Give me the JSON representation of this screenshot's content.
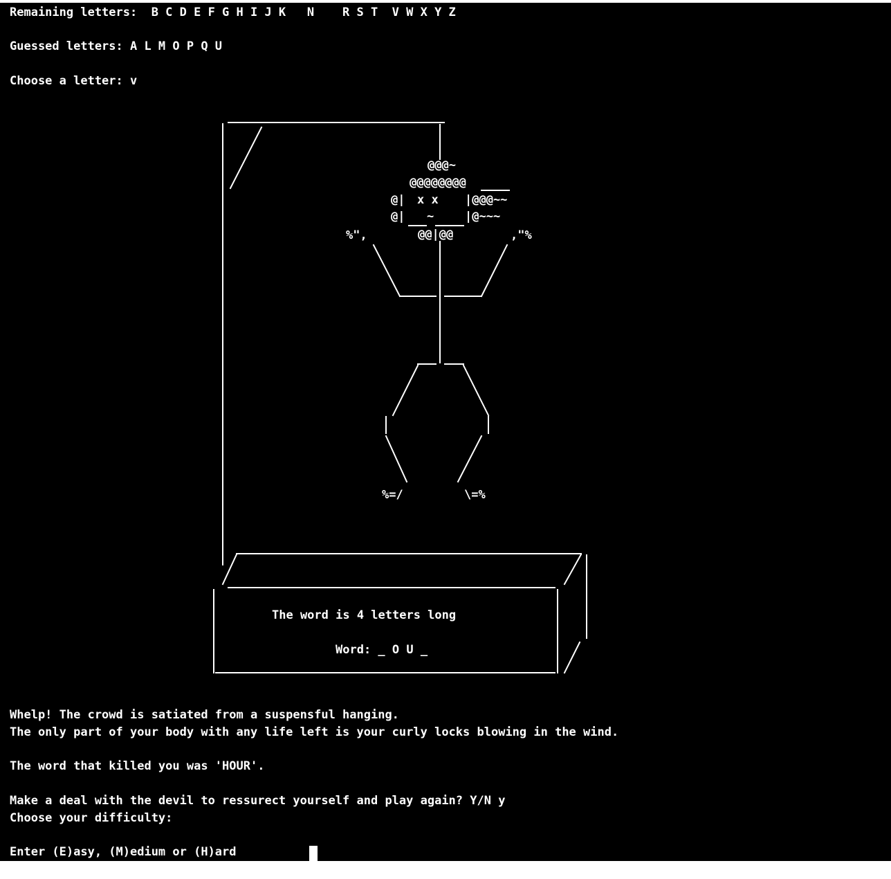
{
  "terminal": {
    "bg_color": "#000000",
    "fg_color": "#ffffff",
    "remaining_line": "Remaining letters:  B C D E F G H I J K   N    R S T  V W X Y Z",
    "guessed_line": "Guessed letters: A L M O P Q U",
    "choose_line": "Choose a letter: v",
    "gallows": {
      "hat_top": "@@@~",
      "hat_brim": "@@@@@@@@",
      "eyes_left": "@|",
      "eyes": "x  x",
      "hair_right_1": "|@@@~~",
      "face_left": "@|",
      "mouth": "~",
      "hair_right_2": "|@~~~",
      "hand_left": "%\",",
      "neck_hair": "@@|@@",
      "hand_right": ",\"%",
      "foot_left": "%=/",
      "foot_right": "\\=%",
      "word_length": "The word is 4 letters long",
      "word_display": "Word: _ O U _"
    },
    "message_line_1": "Whelp! The crowd is satiated from a suspensful hanging.",
    "message_line_2": "The only part of your body with any life left is your curly locks blowing in the wind.",
    "killer_word_line": "The word that killed you was 'HOUR'.",
    "play_again_line": "Make a deal with the devil to ressurect yourself and play again? Y/N y",
    "difficulty_line": "Choose your difficulty:",
    "prompt_line": "Enter (E)asy, (M)edium or (H)ard"
  }
}
